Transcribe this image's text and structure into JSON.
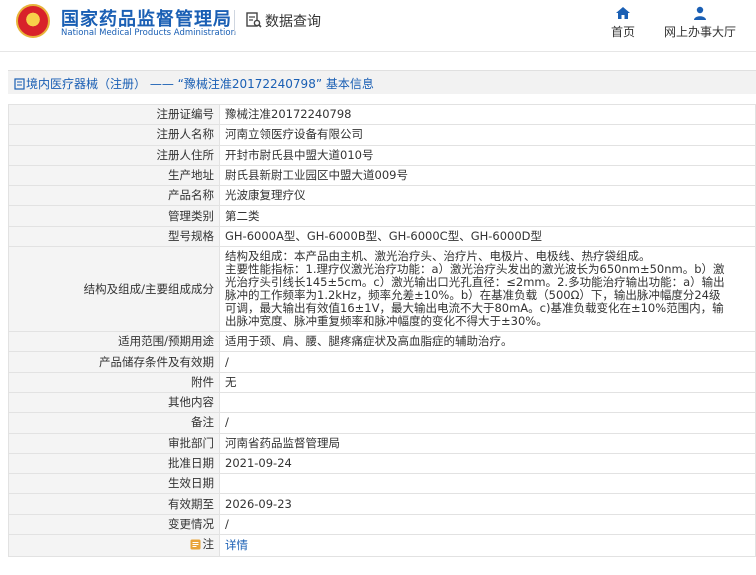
{
  "header": {
    "brand_cn": "国家药品监督管理局",
    "brand_en": "National Medical Products Administration",
    "query_label": "数据查询",
    "nav": [
      {
        "icon": "home-icon",
        "label": "首页"
      },
      {
        "icon": "user-icon",
        "label": "网上办事大厅"
      }
    ]
  },
  "breadcrumb": "境内医疗器械（注册） —— “豫械注准20172240798” 基本信息",
  "rows": [
    {
      "key": "注册证编号",
      "value": "豫械注准20172240798"
    },
    {
      "key": "注册人名称",
      "value": "河南立领医疗设备有限公司"
    },
    {
      "key": "注册人住所",
      "value": "开封市尉氏县中盟大道010号"
    },
    {
      "key": "生产地址",
      "value": "尉氏县新尉工业园区中盟大道009号"
    },
    {
      "key": "产品名称",
      "value": "光波康复理疗仪"
    },
    {
      "key": "管理类别",
      "value": "第二类"
    },
    {
      "key": "型号规格",
      "value": "GH-6000A型、GH-6000B型、GH-6000C型、GH-6000D型"
    },
    {
      "key": "结构及组成/主要组成成分",
      "lines": [
        "结构及组成：本产品由主机、激光治疗头、治疗片、电极片、电极线、热疗袋组成。",
        "主要性能指标：1.理疗仪激光治疗功能：a）激光治疗头发出的激光波长为650nm±50nm。b）激",
        "光治疗头引线长145±5cm。c）激光输出口光孔直径：≤2mm。2.多功能治疗输出功能：a）输出",
        "脉冲的工作频率为1.2kHz，频率允差±10%。b）在基准负载（500Ω）下，输出脉冲幅度分24级",
        "可调，最大输出有效值16±1V，最大输出电流不大于80mA。c)基准负载变化在±10%范围内，输",
        "出脉冲宽度、脉冲重复频率和脉冲幅度的变化不得大于±30%。"
      ]
    },
    {
      "key": "适用范围/预期用途",
      "value": "适用于颈、肩、腰、腿疼痛症状及高血脂症的辅助治疗。"
    },
    {
      "key": "产品储存条件及有效期",
      "value": "/"
    },
    {
      "key": "附件",
      "value": "无"
    },
    {
      "key": "其他内容",
      "value": ""
    },
    {
      "key": "备注",
      "value": "/"
    },
    {
      "key": "审批部门",
      "value": "河南省药品监督管理局"
    },
    {
      "key": "批准日期",
      "value": "2021-09-24"
    },
    {
      "key": "生效日期",
      "value": ""
    },
    {
      "key": "有效期至",
      "value": "2026-09-23"
    },
    {
      "key": "变更情况",
      "value": "/"
    },
    {
      "key": "注",
      "value": "详情",
      "icon": "note-icon"
    }
  ],
  "colors": {
    "brand_blue": "#1a5fb4",
    "label_bg": "#f4f4f4",
    "border": "#e2e2e2"
  }
}
